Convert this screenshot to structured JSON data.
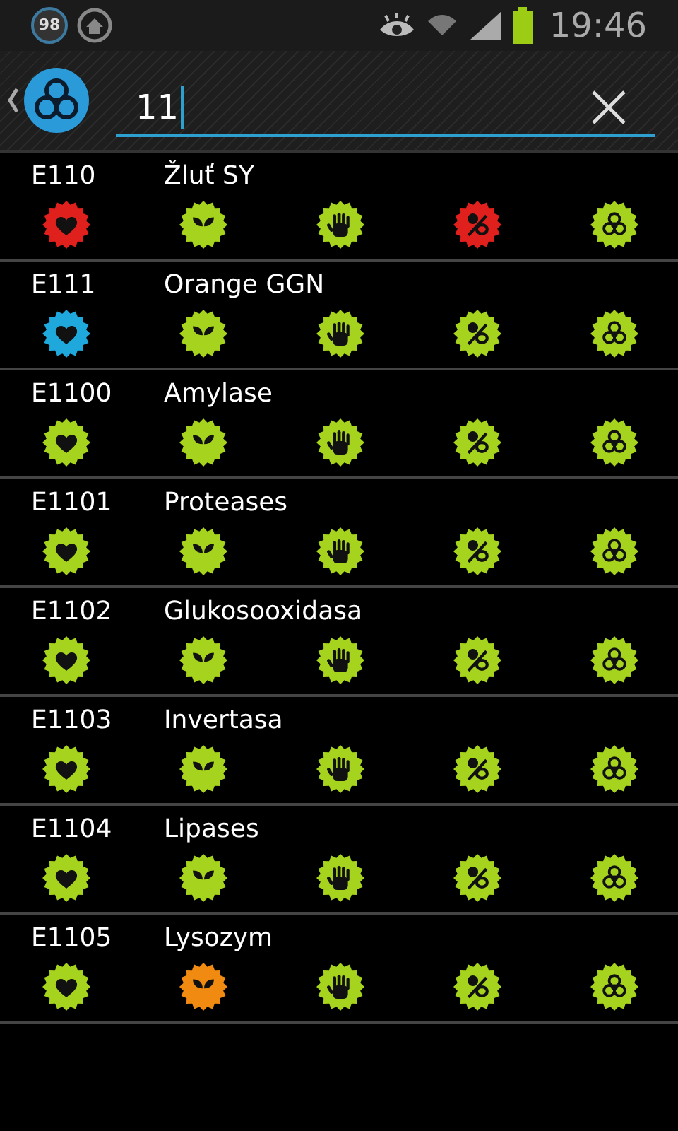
{
  "status_bar": {
    "notification_count": "98",
    "time": "19:46"
  },
  "search": {
    "value": "11"
  },
  "rows": [
    {
      "code": "E110",
      "name": "Žluť SY",
      "badges": [
        {
          "kind": "heart",
          "color": "#e0201c"
        },
        {
          "kind": "leaf",
          "color": "#a6d41e"
        },
        {
          "kind": "hand",
          "color": "#a6d41e"
        },
        {
          "kind": "pacifier",
          "color": "#e0201c"
        },
        {
          "kind": "biohazard",
          "color": "#a6d41e"
        }
      ]
    },
    {
      "code": "E111",
      "name": "Orange GGN",
      "badges": [
        {
          "kind": "heart",
          "color": "#1ea8dc"
        },
        {
          "kind": "leaf",
          "color": "#a6d41e"
        },
        {
          "kind": "hand",
          "color": "#a6d41e"
        },
        {
          "kind": "pacifier",
          "color": "#a6d41e"
        },
        {
          "kind": "biohazard",
          "color": "#a6d41e"
        }
      ]
    },
    {
      "code": "E1100",
      "name": "Amylase",
      "badges": [
        {
          "kind": "heart",
          "color": "#a6d41e"
        },
        {
          "kind": "leaf",
          "color": "#a6d41e"
        },
        {
          "kind": "hand",
          "color": "#a6d41e"
        },
        {
          "kind": "pacifier",
          "color": "#a6d41e"
        },
        {
          "kind": "biohazard",
          "color": "#a6d41e"
        }
      ]
    },
    {
      "code": "E1101",
      "name": "Proteases",
      "badges": [
        {
          "kind": "heart",
          "color": "#a6d41e"
        },
        {
          "kind": "leaf",
          "color": "#a6d41e"
        },
        {
          "kind": "hand",
          "color": "#a6d41e"
        },
        {
          "kind": "pacifier",
          "color": "#a6d41e"
        },
        {
          "kind": "biohazard",
          "color": "#a6d41e"
        }
      ]
    },
    {
      "code": "E1102",
      "name": "Glukosooxidasa",
      "badges": [
        {
          "kind": "heart",
          "color": "#a6d41e"
        },
        {
          "kind": "leaf",
          "color": "#a6d41e"
        },
        {
          "kind": "hand",
          "color": "#a6d41e"
        },
        {
          "kind": "pacifier",
          "color": "#a6d41e"
        },
        {
          "kind": "biohazard",
          "color": "#a6d41e"
        }
      ]
    },
    {
      "code": "E1103",
      "name": "Invertasa",
      "badges": [
        {
          "kind": "heart",
          "color": "#a6d41e"
        },
        {
          "kind": "leaf",
          "color": "#a6d41e"
        },
        {
          "kind": "hand",
          "color": "#a6d41e"
        },
        {
          "kind": "pacifier",
          "color": "#a6d41e"
        },
        {
          "kind": "biohazard",
          "color": "#a6d41e"
        }
      ]
    },
    {
      "code": "E1104",
      "name": "Lipases",
      "badges": [
        {
          "kind": "heart",
          "color": "#a6d41e"
        },
        {
          "kind": "leaf",
          "color": "#a6d41e"
        },
        {
          "kind": "hand",
          "color": "#a6d41e"
        },
        {
          "kind": "pacifier",
          "color": "#a6d41e"
        },
        {
          "kind": "biohazard",
          "color": "#a6d41e"
        }
      ]
    },
    {
      "code": "E1105",
      "name": "Lysozym",
      "badges": [
        {
          "kind": "heart",
          "color": "#a6d41e"
        },
        {
          "kind": "leaf",
          "color": "#f08a10"
        },
        {
          "kind": "hand",
          "color": "#a6d41e"
        },
        {
          "kind": "pacifier",
          "color": "#a6d41e"
        },
        {
          "kind": "biohazard",
          "color": "#a6d41e"
        }
      ]
    }
  ]
}
